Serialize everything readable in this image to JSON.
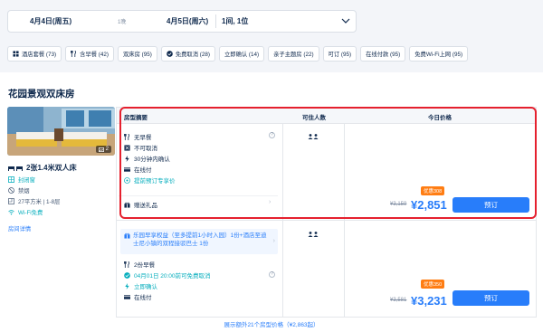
{
  "search": {
    "checkin": "4月4日(周五)",
    "nights": "1晚",
    "checkout": "4月5日(周六)",
    "guests": "1间, 1位"
  },
  "filters": [
    {
      "icon": "hotel-package-icon",
      "label": "酒店套餐 (73)"
    },
    {
      "icon": "fork-knife-icon",
      "label": "含早餐 (42)"
    },
    {
      "icon": "",
      "label": "双床房 (95)"
    },
    {
      "icon": "check-circle-icon",
      "label": "免费取消 (28)"
    },
    {
      "icon": "",
      "label": "立即确认 (14)"
    },
    {
      "icon": "",
      "label": "亲子主题房 (22)"
    },
    {
      "icon": "",
      "label": "可订 (95)"
    },
    {
      "icon": "",
      "label": "在线付款 (95)"
    },
    {
      "icon": "",
      "label": "免费Wi-Fi上网 (95)"
    }
  ],
  "room": {
    "title": "花园景观双床房",
    "photo_count": "2",
    "bed": "2张1.4米双人床",
    "features": [
      "封闭窗",
      "禁烟",
      "27平方米 | 1-8层",
      "Wi-Fi免费"
    ],
    "detail_link": "房间详情"
  },
  "table": {
    "headers": {
      "summary": "房型摘要",
      "guests": "可住人数",
      "price": "今日价格"
    },
    "rows": [
      {
        "inclusions": [
          "无早餐",
          "不可取消",
          "30分钟内确认",
          "在线付",
          "提前预订专享价"
        ],
        "gift": "赠送礼品",
        "badge": "优惠308",
        "original_price": "¥3,159",
        "price": "¥2,851",
        "button": "预订"
      },
      {
        "package": "乐园早享权益（至多提前1小时入园）1份+酒店至迪士尼小镇的双程接驳巴士 1份",
        "inclusions": [
          "2份早餐",
          "04月01日 20:00前可免费取消",
          "立即确认",
          "在线付"
        ],
        "badge": "优惠350",
        "original_price": "¥3,581",
        "price": "¥3,231",
        "button": "预订"
      }
    ]
  },
  "more_link": "展示额外21个房型价格（¥2,863起）",
  "colors": {
    "accent": "#287dfa",
    "highlight": "#e5202e",
    "badge": "#ff7d13",
    "green": "#06aebd"
  }
}
